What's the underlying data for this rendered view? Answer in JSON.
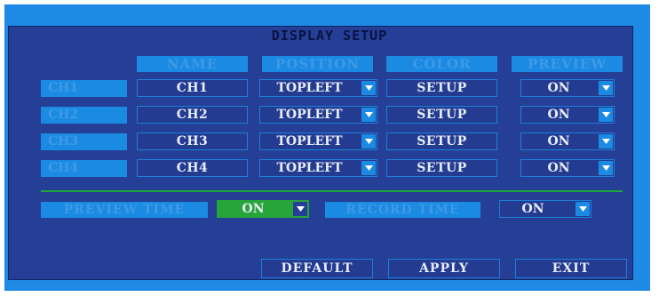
{
  "title": "DISPLAY SETUP",
  "columns": {
    "name": "NAME",
    "position": "POSITION",
    "color": "COLOR",
    "preview": "PREVIEW"
  },
  "channels": [
    {
      "label": "CH1",
      "name": "CH1",
      "position": "TOPLEFT",
      "color": "SETUP",
      "preview": "ON"
    },
    {
      "label": "CH2",
      "name": "CH2",
      "position": "TOPLEFT",
      "color": "SETUP",
      "preview": "ON"
    },
    {
      "label": "CH3",
      "name": "CH3",
      "position": "TOPLEFT",
      "color": "SETUP",
      "preview": "ON"
    },
    {
      "label": "CH4",
      "name": "CH4",
      "position": "TOPLEFT",
      "color": "SETUP",
      "preview": "ON"
    }
  ],
  "options": {
    "preview_time_label": "PREVIEW TIME",
    "preview_time_value": "ON",
    "record_time_label": "RECORD TIME",
    "record_time_value": "ON"
  },
  "buttons": {
    "default": "DEFAULT",
    "apply": "APPLY",
    "exit": "EXIT"
  },
  "colors": {
    "frame": "#1e8ae6",
    "panel": "#243f95",
    "label_bg": "#1b8ae3",
    "highlight": "#27a43a",
    "divider": "#1ea53b",
    "text": "#e8edf8"
  }
}
